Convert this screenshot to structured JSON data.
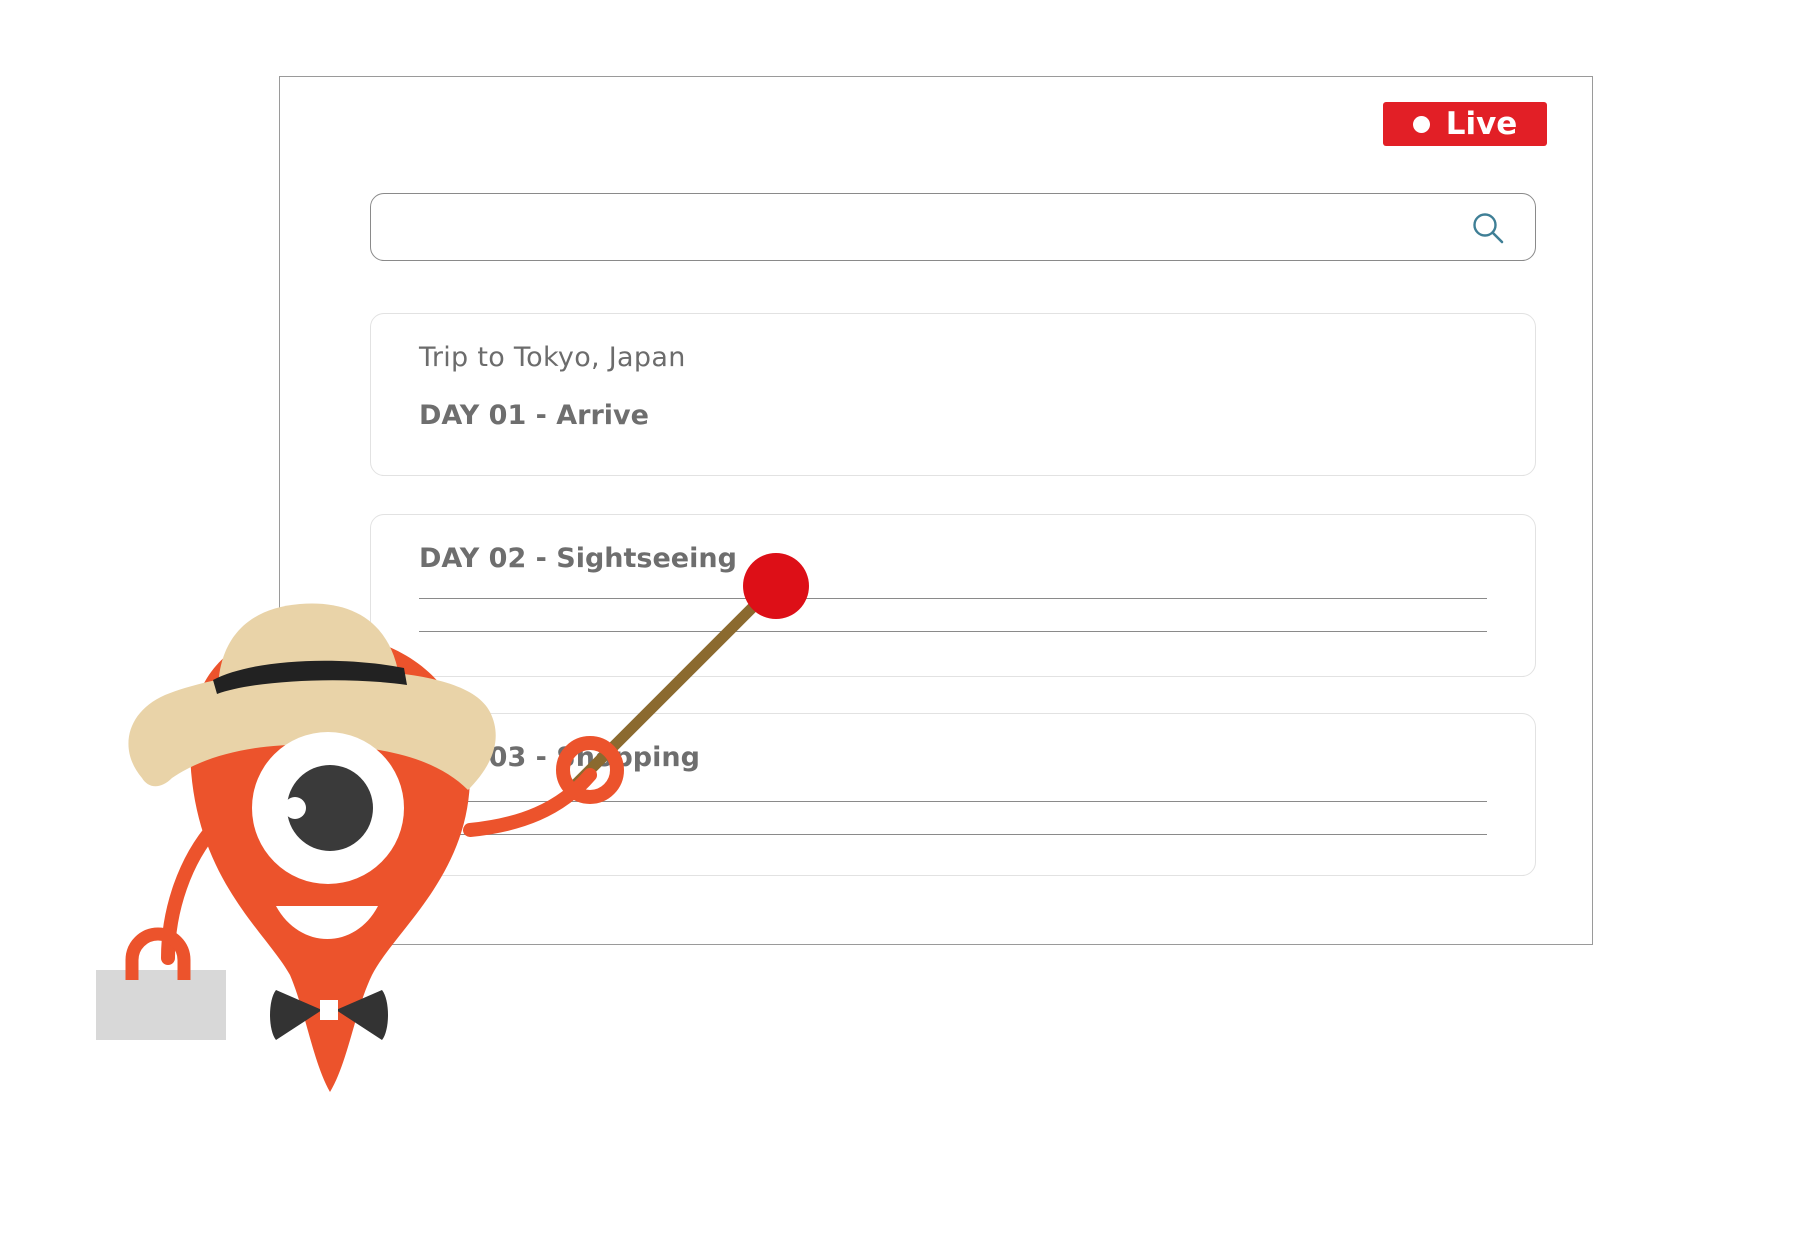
{
  "live_badge": {
    "label": "Live",
    "color": "#e21f26"
  },
  "search": {
    "value": "",
    "placeholder": "",
    "icon": "search-icon"
  },
  "cards": [
    {
      "trip": "Trip to Tokyo, Japan",
      "title": "DAY 01 - Arrive"
    },
    {
      "title": "DAY 02 - Sightseeing"
    },
    {
      "title": "DAY 03 - Shopping"
    }
  ],
  "mascot": {
    "icon": "map-pin-mascot-icon",
    "colors": {
      "body": "#ec532c",
      "hat": "#e9d3a8",
      "pointer_tip": "#dd0f17"
    }
  }
}
